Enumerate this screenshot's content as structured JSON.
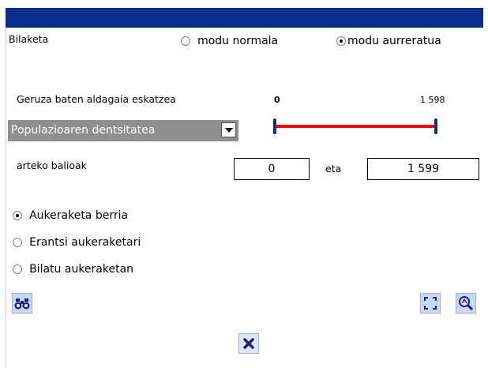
{
  "header": {
    "title": "Bilaketa"
  },
  "mode": {
    "normal_label": "modu normala",
    "advanced_label": "modu aurreratua",
    "selected": "advanced"
  },
  "query": {
    "label": "Geruza baten aldagaia eskatzea",
    "variable_selected": "Populazioaren dentsitatea"
  },
  "slider": {
    "min_label": "0",
    "max_label": "1 598",
    "low_fraction": 0.0,
    "high_fraction": 1.0,
    "track_color": "#ff0000",
    "handle_color": "#1c2a7a"
  },
  "range": {
    "label": "arteko balioak",
    "from_value": "0",
    "conjunction": "eta",
    "to_value": "1 599"
  },
  "selection_options": [
    {
      "label": "Aukeraketa berria",
      "checked": true
    },
    {
      "label": "Erantsi aukeraketari",
      "checked": false
    },
    {
      "label": "Bilatu aukeraketan",
      "checked": false
    }
  ],
  "icons": {
    "search": "binoculars-icon",
    "fullscreen": "fullscreen-icon",
    "zoom": "zoom-icon",
    "close": "close-icon"
  },
  "colors": {
    "header_band": "#0b2c8f",
    "dropdown_bg": "#8f8f8f",
    "icon_bg": "#c9d7f2"
  }
}
